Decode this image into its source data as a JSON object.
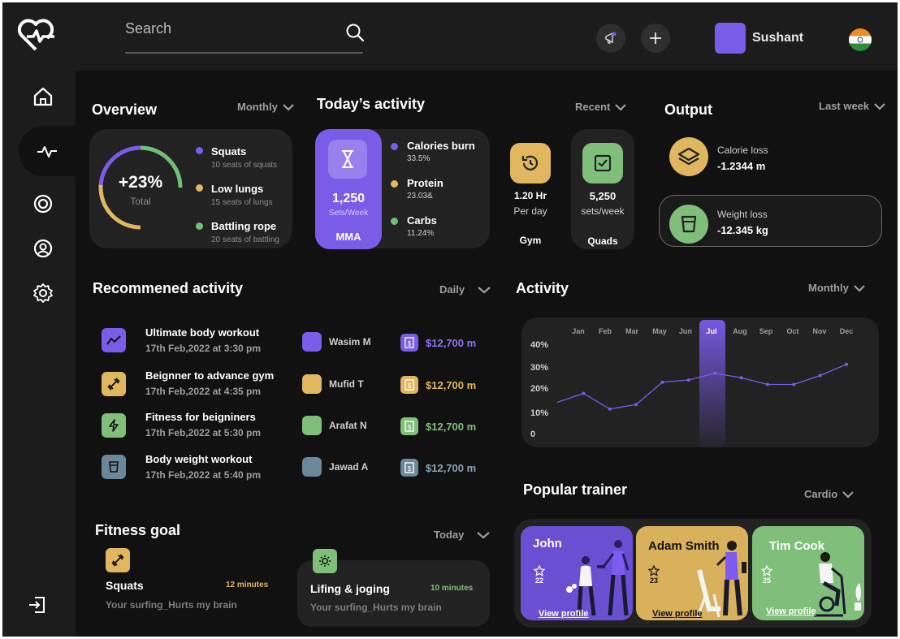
{
  "topbar": {
    "search_placeholder": "Search",
    "user_name": "Sushant"
  },
  "overview": {
    "title": "Overview",
    "filter": "Monthly",
    "percent": "+23%",
    "percent_label": "Total",
    "progress_fraction": 0.23,
    "items": [
      {
        "name": "Squats",
        "sub": "10 seats of squats",
        "color": "#7a5ce8"
      },
      {
        "name": "Low lungs",
        "sub": "15 seats of lungs",
        "color": "#e0b75e"
      },
      {
        "name": "Battling rope",
        "sub": "20 seats of battling",
        "color": "#6fbf74"
      }
    ]
  },
  "today": {
    "title": "Today’s activity",
    "filter": "Recent",
    "mma": {
      "value": "1,250",
      "unit": "Sets/Week",
      "label": "MMA"
    },
    "stats": [
      {
        "name": "Calories burn",
        "value": "33.5%",
        "color": "#7a5ce8"
      },
      {
        "name": "Protein",
        "value": "23.03&",
        "color": "#e0b75e"
      },
      {
        "name": "Carbs",
        "value": "11.24%",
        "color": "#6fbf74"
      }
    ],
    "gym": {
      "value": "1.20 Hr",
      "unit": "Per day",
      "label": "Gym"
    },
    "quads": {
      "value": "5,250",
      "unit": "sets/week",
      "label": "Quads"
    }
  },
  "output": {
    "title": "Output",
    "filter": "Last week",
    "items": [
      {
        "name": "Calorie loss",
        "value": "-1.2344 m"
      },
      {
        "name": "Weight loss",
        "value": "-12.345 kg"
      }
    ]
  },
  "recommended": {
    "title": "Recommened activity",
    "filter": "Daily",
    "rows": [
      {
        "title": "Ultimate body workout",
        "date": "17th Feb,2022 at 3:30 pm",
        "person": "Wasim M",
        "amount": "$12,700 m",
        "color": "#7a5ce8"
      },
      {
        "title": "Beignner to advance gym",
        "date": "17th Feb,2022 at 4:35 pm",
        "person": "Mufid T",
        "amount": "$12,700 m",
        "color": "#e0b75e"
      },
      {
        "title": "Fitness for beigniners",
        "date": "17th Feb,2022 at 5:30 pm",
        "person": "Arafat N",
        "amount": "$12,700 m",
        "color": "#6fbf74"
      },
      {
        "title": "Body weight workout",
        "date": "17th Feb,2022 at 5:40 pm",
        "person": "Jawad A",
        "amount": "$12,700 m",
        "color": "#6b8799"
      }
    ]
  },
  "activity": {
    "title": "Activity",
    "filter": "Monthly"
  },
  "chart_data": {
    "type": "line",
    "x": [
      "Jan",
      "Feb",
      "Mar",
      "May",
      "Jun",
      "Jul",
      "Aug",
      "Sep",
      "Oct",
      "Nov",
      "Dec"
    ],
    "series": [
      {
        "values": [
          14,
          18,
          11,
          13,
          23,
          24,
          27,
          25,
          22,
          22,
          26,
          31
        ]
      }
    ],
    "y_ticks": [
      "40%",
      "30%",
      "20%",
      "10%",
      "0"
    ],
    "highlight": "Jul",
    "ylim": [
      0,
      40
    ],
    "line_color": "#7a5ce8"
  },
  "fitness_goal": {
    "title": "Fitness goal",
    "filter": "Today",
    "items": [
      {
        "name": "Squats",
        "time": "12 minutes",
        "sub": "Your  surfing_Hurts my brain"
      },
      {
        "name": "Lifing & joging",
        "time": "10 minutes",
        "sub": "Your  surfing_Hurts my brain"
      }
    ]
  },
  "trainers": {
    "title": "Popular trainer",
    "filter": "Cardio",
    "cards": [
      {
        "name": "John",
        "rating": "22",
        "link": "View profile",
        "bg": "#6a4fd3"
      },
      {
        "name": "Adam Smith",
        "rating": "23",
        "link": "View profile",
        "bg": "#d8b15a"
      },
      {
        "name": "Tim Cook",
        "rating": "25",
        "link": "View profile",
        "bg": "#7fbf7a"
      }
    ]
  }
}
